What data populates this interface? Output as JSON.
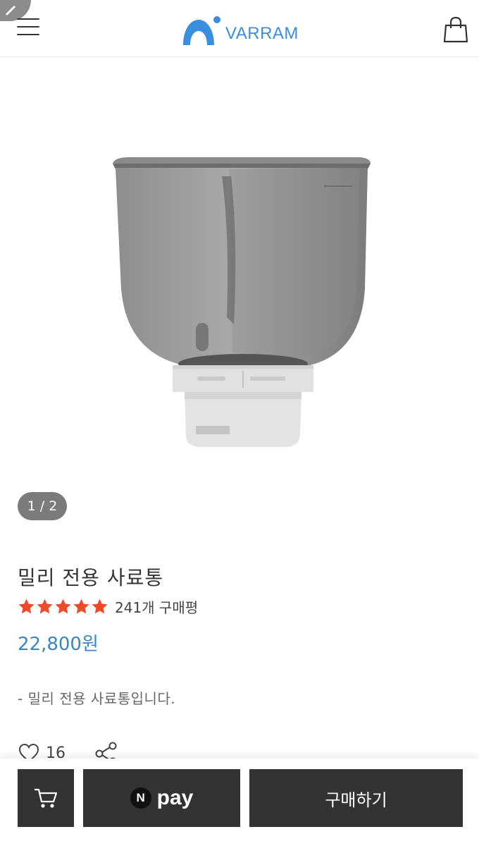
{
  "header": {
    "brand": "VARRAM",
    "menu_icon": "hamburger-menu-icon",
    "bag_icon": "shopping-bag-icon",
    "edit_icon": "pencil-icon"
  },
  "gallery": {
    "pager": "1 / 2"
  },
  "product": {
    "title": "밀리 전용 사료통",
    "rating_stars": 5,
    "review_count": "241개 구매평",
    "price": "22,800원",
    "description": "- 밀리 전용 사료통입니다.",
    "likes": "16"
  },
  "actions": {
    "npay_badge": "N",
    "npay_label": "pay",
    "buy_label": "구매하기",
    "cart_icon": "cart-icon"
  },
  "colors": {
    "brand_blue": "#3a8ee0",
    "price_blue": "#3a86c3",
    "star_red": "#f04a2b",
    "button_dark": "#333333"
  }
}
